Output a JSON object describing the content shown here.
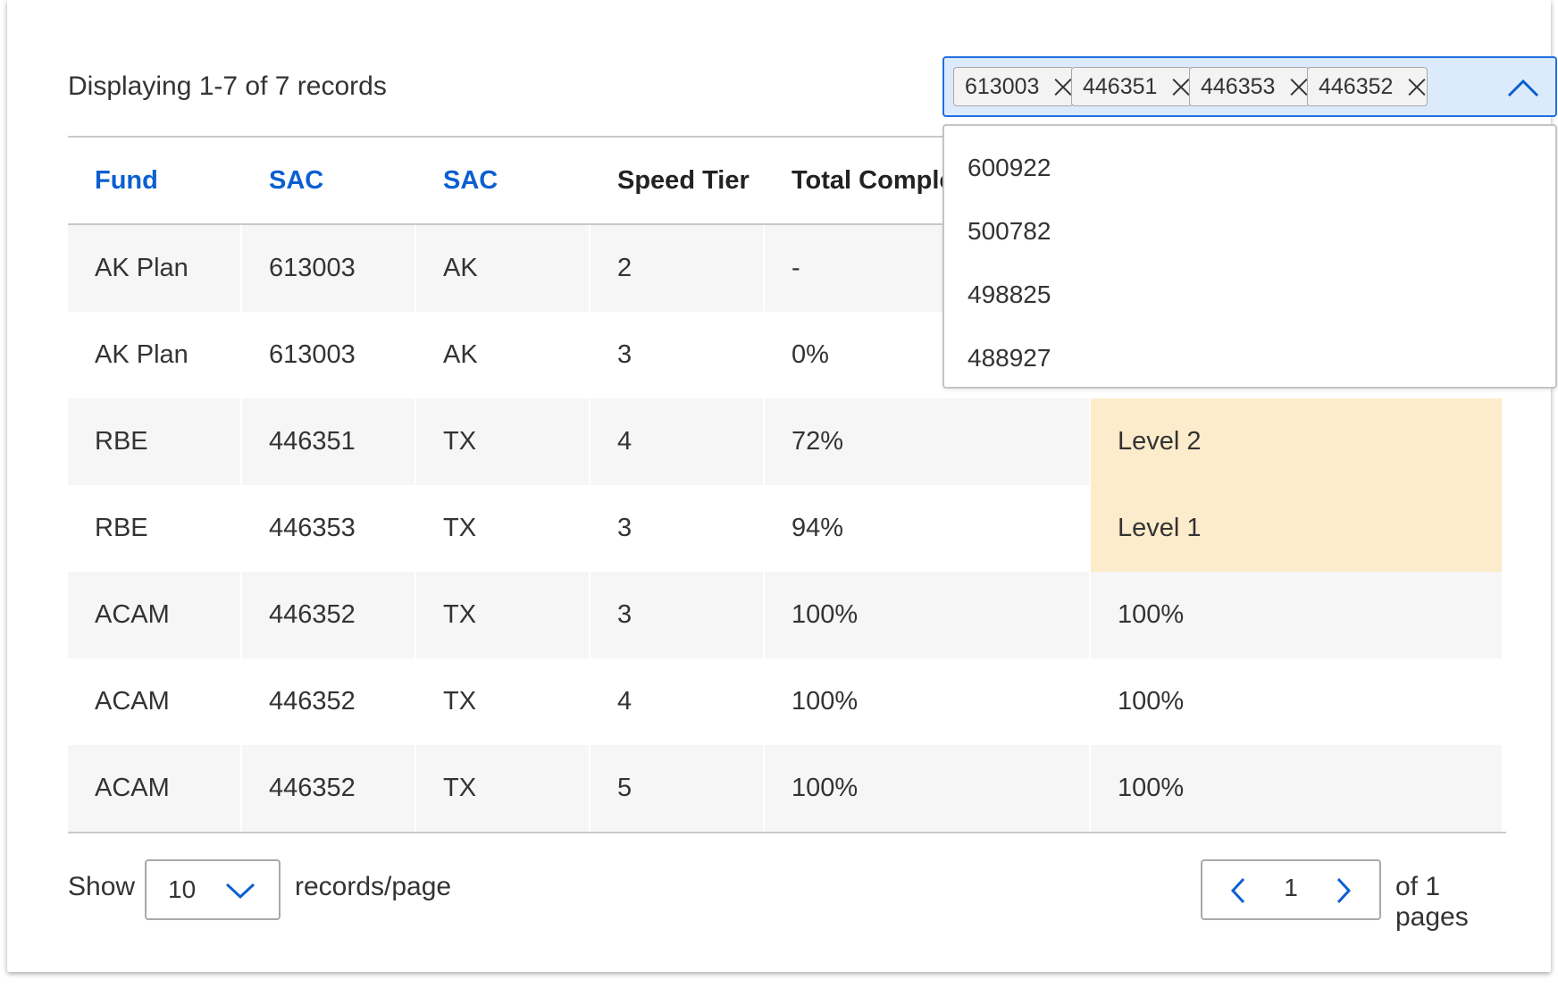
{
  "header": {
    "record_count": "Displaying 1-7 of 7 records"
  },
  "filter": {
    "chips": [
      "613003",
      "446351",
      "446353",
      "446352"
    ],
    "options": [
      "600922",
      "500782",
      "498825",
      "488927"
    ]
  },
  "table": {
    "columns": [
      {
        "label": "Fund",
        "sortable": true
      },
      {
        "label": "SAC",
        "sortable": true
      },
      {
        "label": "SAC",
        "sortable": true
      },
      {
        "label": "Speed Tier",
        "sortable": false
      },
      {
        "label": "Total Completion",
        "sortable": false
      },
      {
        "label": "",
        "sortable": false
      }
    ],
    "rows": [
      [
        "AK Plan",
        "613003",
        "AK",
        "2",
        "-",
        ""
      ],
      [
        "AK Plan",
        "613003",
        "AK",
        "3",
        "0%",
        ""
      ],
      [
        "RBE",
        "446351",
        "TX",
        "4",
        "72%",
        "Level 2"
      ],
      [
        "RBE",
        "446353",
        "TX",
        "3",
        "94%",
        "Level 1"
      ],
      [
        "ACAM",
        "446352",
        "TX",
        "3",
        "100%",
        "100%"
      ],
      [
        "ACAM",
        "446352",
        "TX",
        "4",
        "100%",
        "100%"
      ],
      [
        "ACAM",
        "446352",
        "TX",
        "5",
        "100%",
        "100%"
      ]
    ],
    "highlight_color": "#fdeccb"
  },
  "footer": {
    "show_label": "Show",
    "page_size": "10",
    "per_page_label": "records/page",
    "current_page": "1",
    "of_pages_label": "of 1 pages"
  },
  "colors": {
    "accent": "#0b5fd0",
    "select_bg": "#dcebfc"
  }
}
